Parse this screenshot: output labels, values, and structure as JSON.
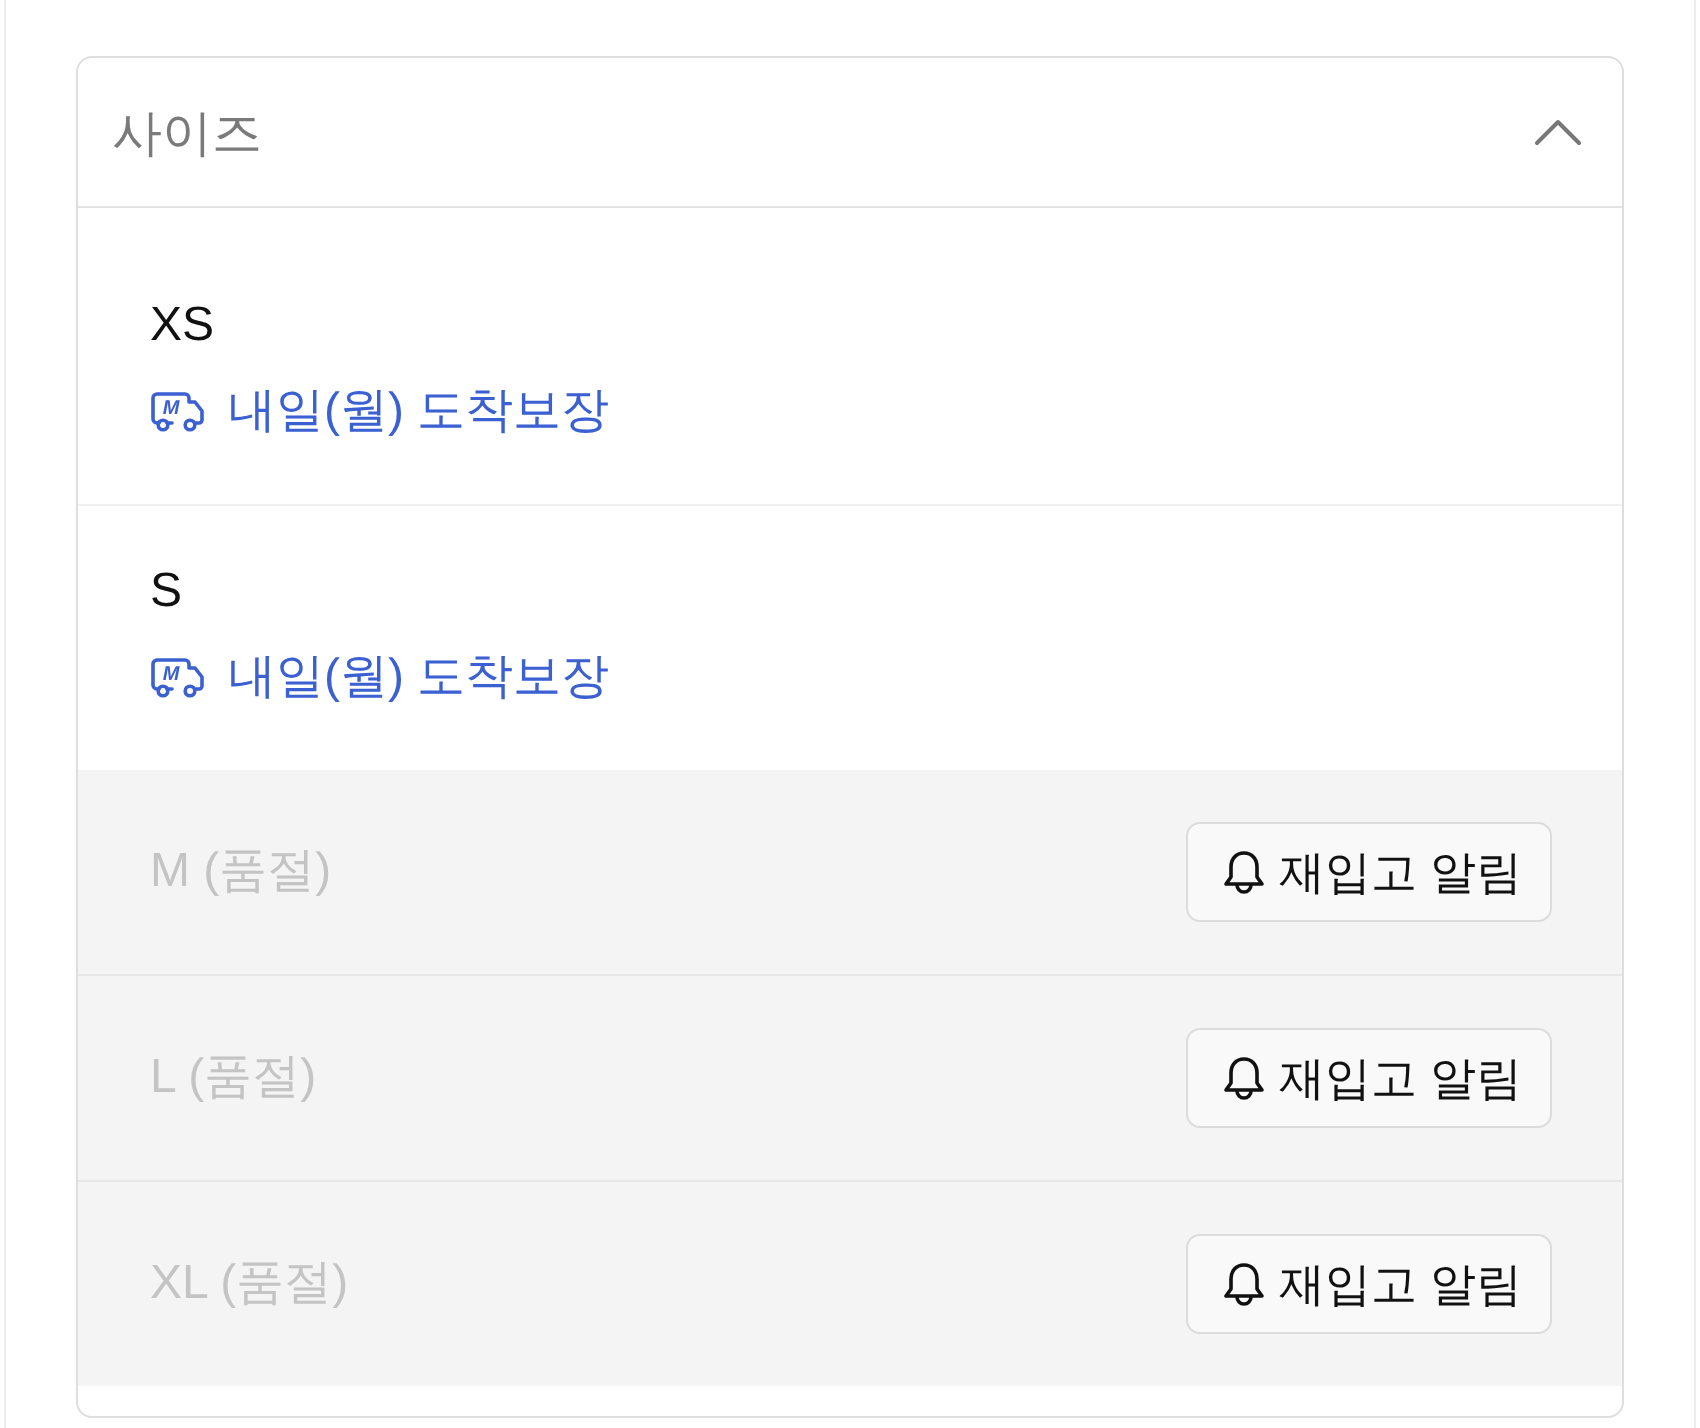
{
  "size_select": {
    "label": "사이즈",
    "expanded": true,
    "options": [
      {
        "kind": "available",
        "size": "XS",
        "badge": "M",
        "delivery": "내일(월) 도착보장"
      },
      {
        "kind": "available",
        "size": "S",
        "badge": "M",
        "delivery": "내일(월) 도착보장"
      },
      {
        "kind": "sold_out",
        "size": "M (품절)",
        "button": "재입고 알림"
      },
      {
        "kind": "sold_out",
        "size": "L (품절)",
        "button": "재입고 알림"
      },
      {
        "kind": "sold_out",
        "size": "XL (품절)",
        "button": "재입고 알림"
      }
    ]
  }
}
